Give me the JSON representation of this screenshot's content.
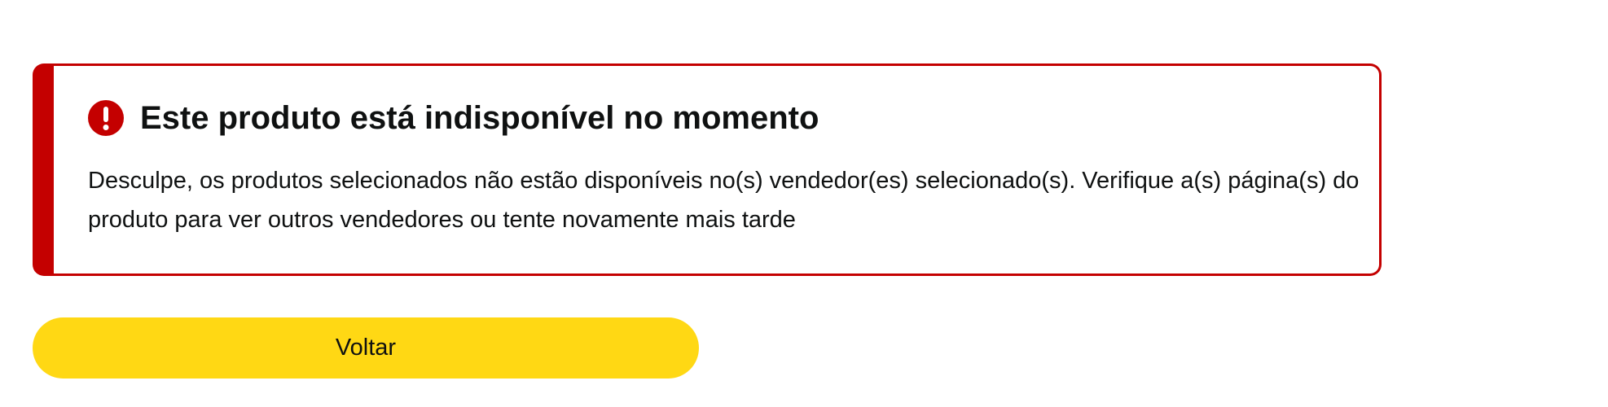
{
  "alert": {
    "icon": "exclamation-circle-icon",
    "title": "Este produto está indisponível no momento",
    "message": "Desculpe, os produtos selecionados não estão disponíveis no(s) vendedor(es) selecionado(s). Verifique a(s) página(s) do produto para ver outros vendedores ou tente novamente mais tarde",
    "accent_color": "#c40000"
  },
  "actions": {
    "back_label": "Voltar",
    "button_color": "#ffd814"
  }
}
